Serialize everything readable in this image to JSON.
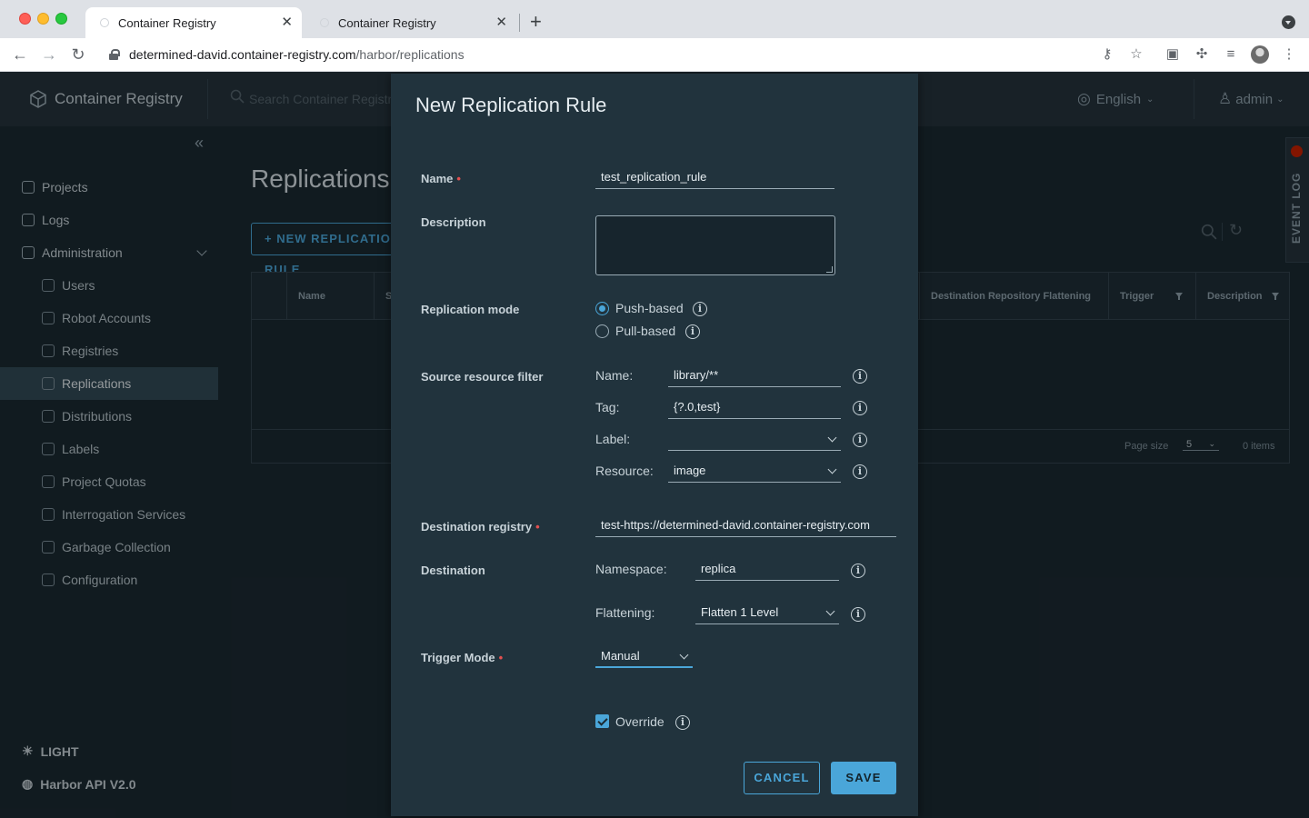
{
  "browser": {
    "tabs": [
      {
        "title": "Container Registry",
        "active": true
      },
      {
        "title": "Container Registry",
        "active": false
      }
    ],
    "url_host": "determined-david.container-registry.com",
    "url_path": "/harbor/replications"
  },
  "app": {
    "brand": "Container Registry",
    "search_placeholder": "Search Container Registry...",
    "language": "English",
    "user": "admin"
  },
  "sidebar": {
    "items": [
      {
        "label": "Projects",
        "icon": "projects-icon"
      },
      {
        "label": "Logs",
        "icon": "logs-icon"
      },
      {
        "label": "Administration",
        "icon": "administration-icon"
      }
    ],
    "admin_items": [
      {
        "label": "Users"
      },
      {
        "label": "Robot Accounts"
      },
      {
        "label": "Registries"
      },
      {
        "label": "Replications",
        "active": true
      },
      {
        "label": "Distributions"
      },
      {
        "label": "Labels"
      },
      {
        "label": "Project Quotas"
      },
      {
        "label": "Interrogation Services"
      },
      {
        "label": "Garbage Collection"
      },
      {
        "label": "Configuration"
      }
    ],
    "theme_toggle": "LIGHT",
    "api_link": "Harbor API V2.0"
  },
  "page": {
    "title": "Replications",
    "new_button": "+ NEW REPLICATION RULE",
    "columns": [
      "Name",
      "S",
      "Destination Repository Flattening",
      "Trigger",
      "Description"
    ],
    "page_size_label": "Page size",
    "page_size": "5",
    "items_count": "0 items",
    "event_log": "EVENT LOG"
  },
  "modal": {
    "title": "New Replication Rule",
    "name_label": "Name",
    "name_value": "test_replication_rule",
    "description_label": "Description",
    "description_value": "",
    "replication_mode_label": "Replication mode",
    "mode_push": "Push-based",
    "mode_pull": "Pull-based",
    "selected_mode": "Push-based",
    "source_filter_label": "Source resource filter",
    "filter_name_label": "Name:",
    "filter_name_value": "library/**",
    "filter_tag_label": "Tag:",
    "filter_tag_value": "{?.0,test}",
    "filter_label_label": "Label:",
    "filter_label_value": "",
    "filter_resource_label": "Resource:",
    "filter_resource_value": "image",
    "dest_registry_label": "Destination registry",
    "dest_registry_value": "test-https://determined-david.container-registry.com",
    "destination_label": "Destination",
    "namespace_label": "Namespace:",
    "namespace_value": "replica",
    "flattening_label": "Flattening:",
    "flattening_value": "Flatten 1 Level",
    "trigger_label": "Trigger Mode",
    "trigger_value": "Manual",
    "override_label": "Override",
    "override_checked": true,
    "cancel": "CANCEL",
    "save": "SAVE"
  },
  "colors": {
    "accent": "#4aa6d9",
    "required": "#e25050",
    "modal_bg": "#21333d",
    "app_bg": "#1b2a32"
  }
}
